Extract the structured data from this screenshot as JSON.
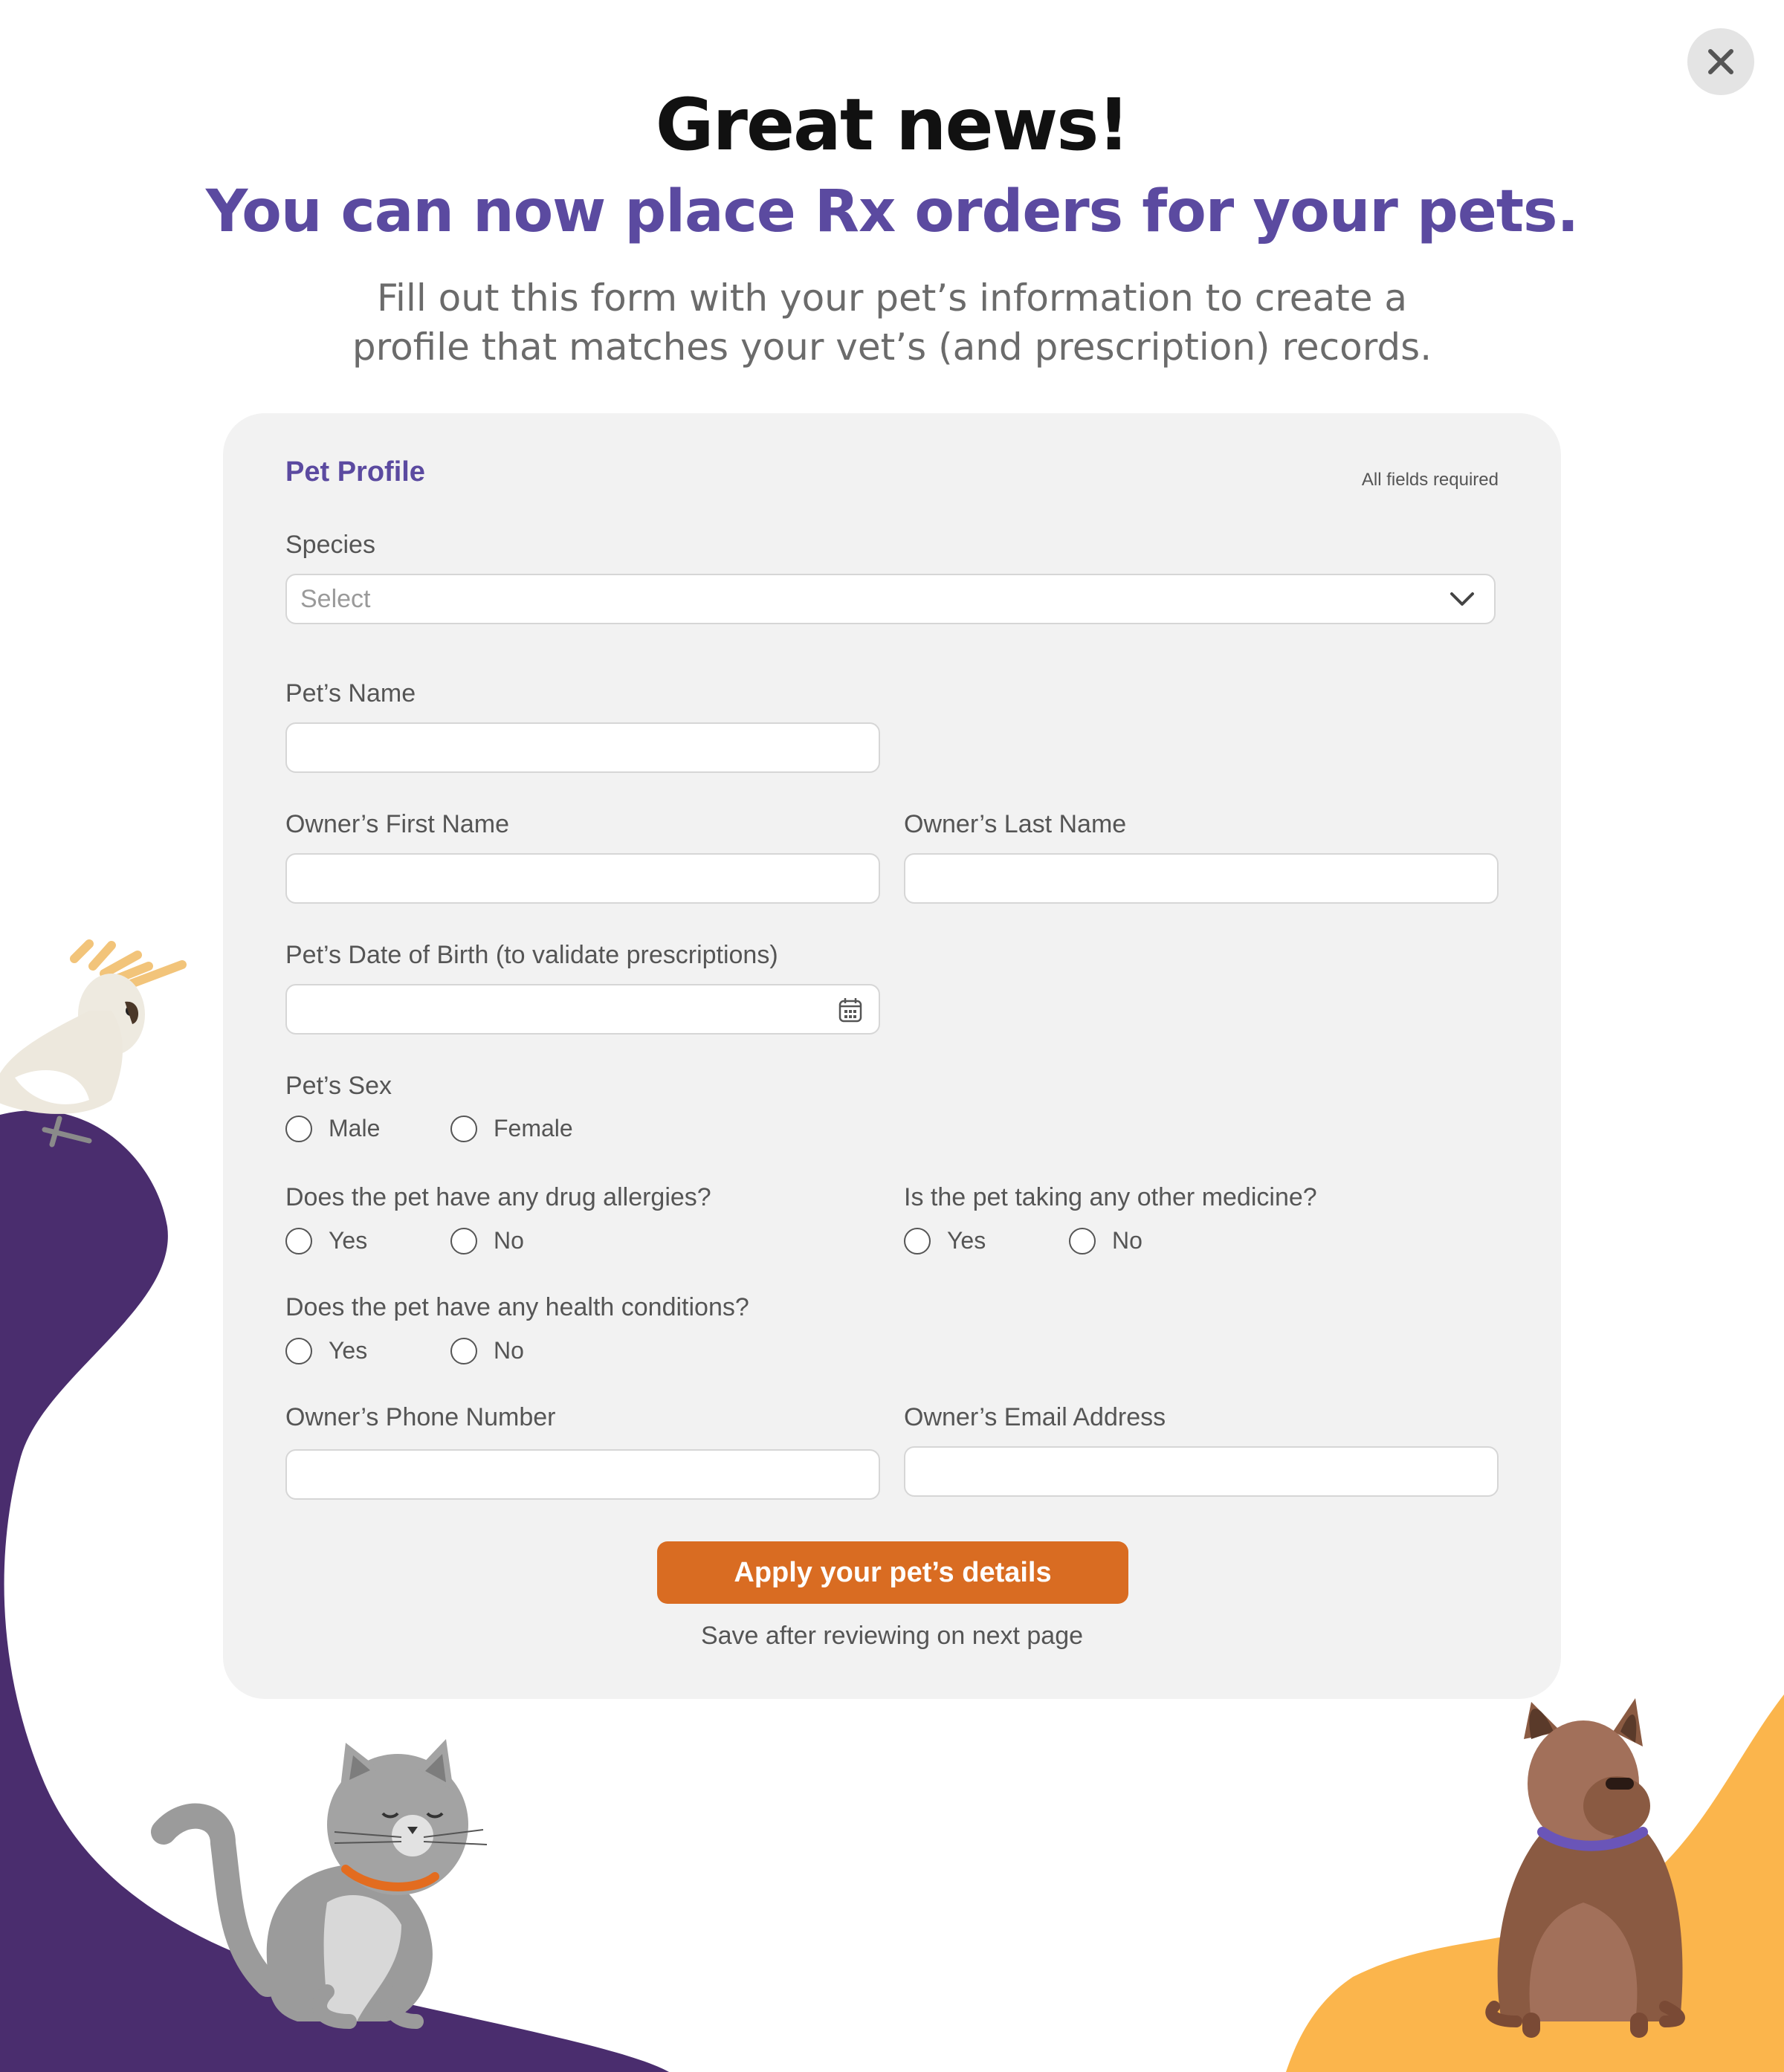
{
  "header": {
    "title": "Great news!",
    "subtitle": "You can now place Rx orders for your pets.",
    "description_line1": "Fill out this form with your pet’s information to create a",
    "description_line2": "profile that matches your vet’s (and prescription) records."
  },
  "close_icon": "close-icon",
  "form": {
    "title": "Pet Profile",
    "required_note": "All fields required",
    "species": {
      "label": "Species",
      "placeholder": "Select",
      "value": ""
    },
    "pet_name": {
      "label": "Pet’s Name",
      "value": ""
    },
    "owner_first_name": {
      "label": "Owner’s First Name",
      "value": ""
    },
    "owner_last_name": {
      "label": "Owner’s Last Name",
      "value": ""
    },
    "pet_dob": {
      "label": "Pet’s Date of Birth (to validate prescriptions)",
      "value": ""
    },
    "pet_sex": {
      "label": "Pet’s Sex",
      "options": [
        "Male",
        "Female"
      ],
      "selected": null
    },
    "drug_allergies": {
      "label": "Does the pet have any drug allergies?",
      "options": [
        "Yes",
        "No"
      ],
      "selected": null
    },
    "other_medicine": {
      "label": "Is the pet taking any other medicine?",
      "options": [
        "Yes",
        "No"
      ],
      "selected": null
    },
    "health_conditions": {
      "label": "Does the pet have any health conditions?",
      "options": [
        "Yes",
        "No"
      ],
      "selected": null
    },
    "owner_phone": {
      "label": "Owner’s Phone Number",
      "value": ""
    },
    "owner_email": {
      "label": "Owner’s Email Address",
      "value": ""
    },
    "submit_label": "Apply your pet’s details",
    "submit_note": "Save after reviewing on next page"
  },
  "colors": {
    "accent_purple": "#5b4aa0",
    "dark_purple_wave": "#4a2d6e",
    "orange_button": "#d96c22",
    "yellow_wave": "#fbb54c",
    "card_background": "#f2f2f2"
  }
}
